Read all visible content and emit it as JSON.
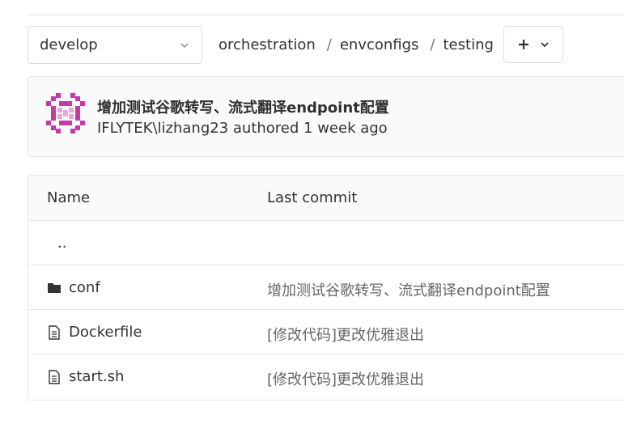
{
  "branch": {
    "selected": "develop",
    "chevron_icon": "chevron-down-icon"
  },
  "breadcrumb": {
    "segments": [
      "orchestration",
      "envconfigs",
      "testing"
    ],
    "separator": "/",
    "add_icon": "plus-icon",
    "add_dropdown_icon": "chevron-down-icon"
  },
  "commit": {
    "title": "增加测试谷歌转写、流式翻译endpoint配置",
    "meta": "IFLYTEK\\lizhang23 authored 1 week ago",
    "avatar_color": "#c23ba6"
  },
  "table": {
    "headers": [
      "Name",
      "Last commit"
    ],
    "rows": [
      {
        "name": "..",
        "icon": "",
        "last_commit": ""
      },
      {
        "name": "conf",
        "icon": "folder-icon",
        "last_commit": "增加测试谷歌转写、流式翻译endpoint配置"
      },
      {
        "name": "Dockerfile",
        "icon": "file-icon",
        "last_commit": "[修改代码]更改优雅退出"
      },
      {
        "name": "start.sh",
        "icon": "file-icon",
        "last_commit": "[修改代码]更改优雅退出"
      }
    ]
  }
}
